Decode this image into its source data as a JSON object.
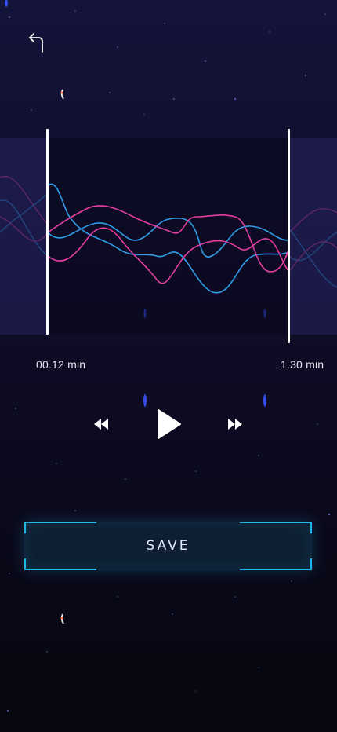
{
  "header": {
    "back_icon": "back-arrow-icon"
  },
  "trimmer": {
    "start_time": "00.12 min",
    "end_time": "1.30 min",
    "wave_colors": {
      "pink": "#e23fa0",
      "blue": "#2f9de8"
    }
  },
  "playback": {
    "rewind_icon": "rewind-icon",
    "play_icon": "play-icon",
    "forward_icon": "fast-forward-icon"
  },
  "actions": {
    "save_label": "SAVE",
    "accent_color": "#1fb6ee"
  }
}
